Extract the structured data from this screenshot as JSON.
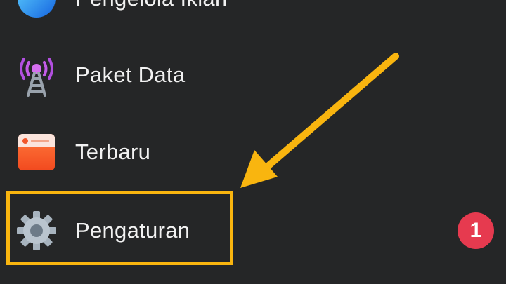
{
  "menu": {
    "items": [
      {
        "label": "Pengelola Iklan",
        "icon": "ads-manager-icon"
      },
      {
        "label": "Paket Data",
        "icon": "cell-tower-icon"
      },
      {
        "label": "Terbaru",
        "icon": "recent-feed-icon"
      },
      {
        "label": "Pengaturan",
        "icon": "gear-icon"
      }
    ]
  },
  "annotation": {
    "step_number": "1",
    "highlight_color": "#f9b50f",
    "badge_color": "#e63a4f"
  }
}
